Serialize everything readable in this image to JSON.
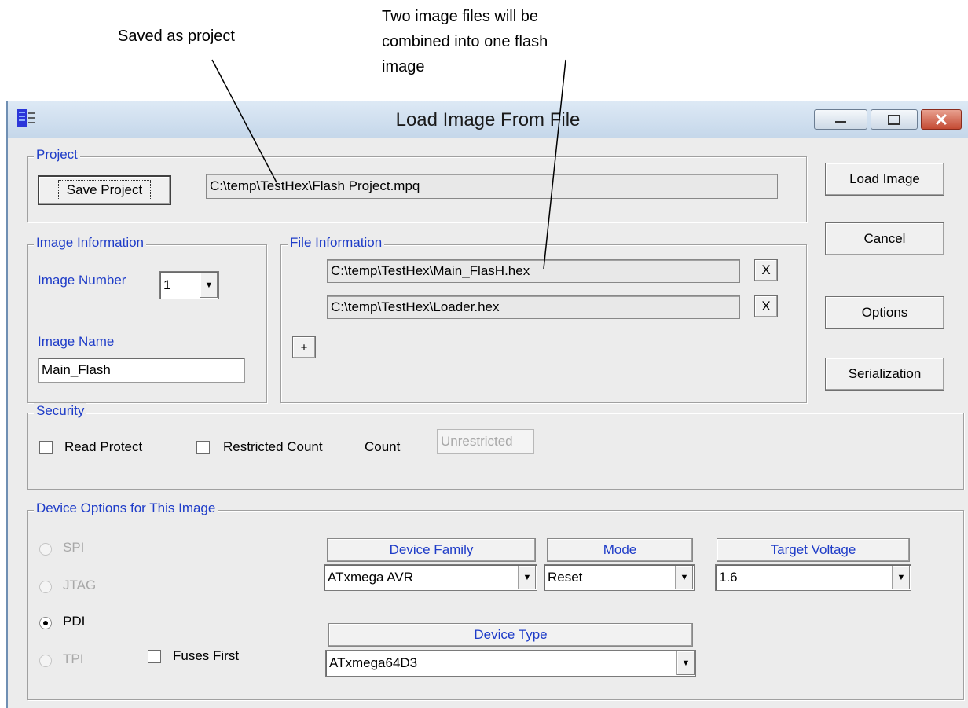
{
  "annotations": {
    "saved_as_project": "Saved as project",
    "two_image_files_line1": "Two image files will be",
    "two_image_files_line2": "combined into one flash",
    "two_image_files_line3": "image"
  },
  "window": {
    "title": "Load Image From File",
    "minimize_icon": "minimize-icon",
    "maximize_icon": "maximize-icon",
    "close_icon": "close-icon"
  },
  "project": {
    "legend": "Project",
    "save_label": "Save Project",
    "path": "C:\\temp\\TestHex\\Flash Project.mpq"
  },
  "side_buttons": {
    "load_image": "Load Image",
    "cancel": "Cancel",
    "options": "Options",
    "serialization": "Serialization"
  },
  "image_info": {
    "legend": "Image Information",
    "number_label": "Image Number",
    "number_value": "1",
    "name_label": "Image Name",
    "name_value": "Main_Flash"
  },
  "file_info": {
    "legend": "File Information",
    "files": [
      "C:\\temp\\TestHex\\Main_FlasH.hex",
      "C:\\temp\\TestHex\\Loader.hex"
    ],
    "remove_label": "X",
    "add_label": "+"
  },
  "security": {
    "legend": "Security",
    "read_protect": "Read Protect",
    "restricted_count": "Restricted Count",
    "count_label": "Count",
    "count_value": "Unrestricted"
  },
  "device_options": {
    "legend": "Device Options for This Image",
    "interfaces": [
      "SPI",
      "JTAG",
      "PDI",
      "TPI"
    ],
    "selected_interface": "PDI",
    "fuses_first": "Fuses First",
    "device_family_label": "Device Family",
    "device_family_value": "ATxmega AVR",
    "mode_label": "Mode",
    "mode_value": "Reset",
    "target_voltage_label": "Target Voltage",
    "target_voltage_value": "1.6",
    "device_type_label": "Device Type",
    "device_type_value": "ATxmega64D3"
  }
}
